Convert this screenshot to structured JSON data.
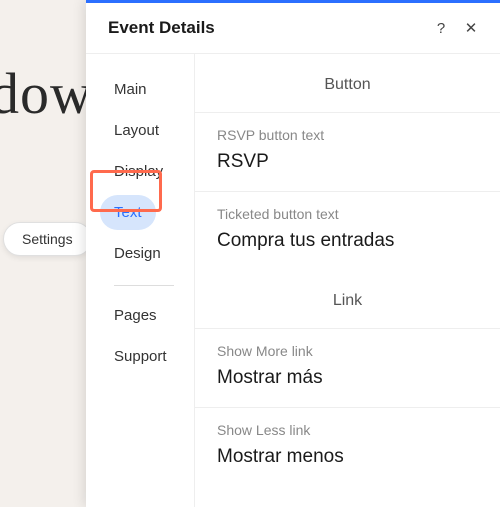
{
  "background": {
    "text": "dow",
    "settingsLabel": "Settings"
  },
  "panel": {
    "title": "Event Details",
    "helpLabel": "?",
    "closeLabel": "✕"
  },
  "sidebar": {
    "items": [
      {
        "label": "Main"
      },
      {
        "label": "Layout"
      },
      {
        "label": "Display"
      },
      {
        "label": "Text",
        "selected": true
      },
      {
        "label": "Design"
      }
    ],
    "secondary": [
      {
        "label": "Pages"
      },
      {
        "label": "Support"
      }
    ]
  },
  "content": {
    "sections": [
      {
        "header": "Button",
        "fields": [
          {
            "label": "RSVP button text",
            "value": "RSVP"
          },
          {
            "label": "Ticketed button text",
            "value": "Compra tus entradas"
          }
        ]
      },
      {
        "header": "Link",
        "fields": [
          {
            "label": "Show More link",
            "value": "Mostrar más"
          },
          {
            "label": "Show Less link",
            "value": "Mostrar menos"
          }
        ]
      }
    ]
  }
}
